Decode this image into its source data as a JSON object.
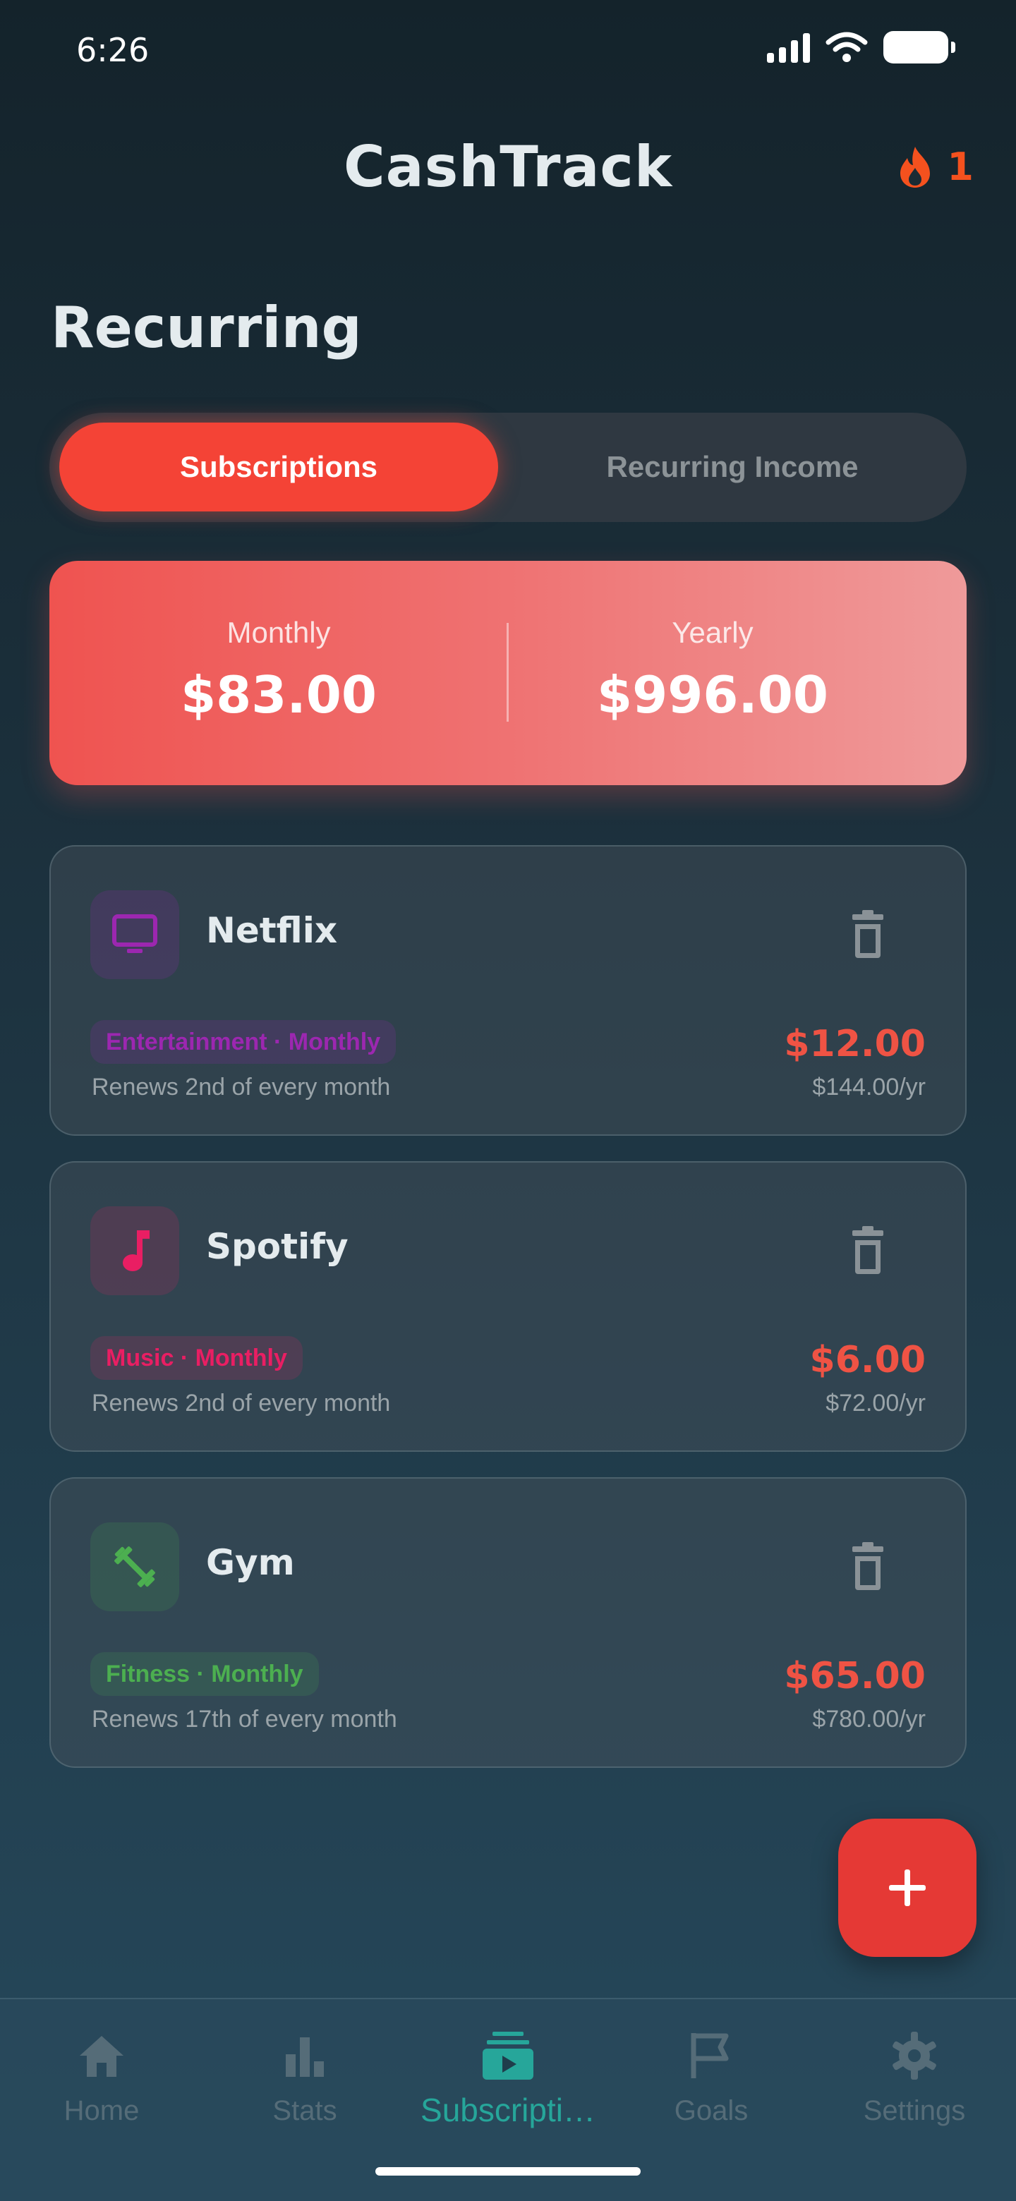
{
  "status_bar": {
    "time": "6:26"
  },
  "header": {
    "title": "CashTrack",
    "streak_count": "1"
  },
  "page": {
    "title": "Recurring"
  },
  "segmented": {
    "active": "Subscriptions",
    "inactive": "Recurring Income"
  },
  "summary": {
    "monthly_label": "Monthly",
    "monthly_value": "$83.00",
    "yearly_label": "Yearly",
    "yearly_value": "$996.00"
  },
  "subscriptions": [
    {
      "name": "Netflix",
      "icon": "tv-icon",
      "badge": "Entertainment · Monthly",
      "renews": "Renews 2nd of every month",
      "amount": "$12.00",
      "yearly": "$144.00/yr",
      "color": "#9c27b0"
    },
    {
      "name": "Spotify",
      "icon": "music-note-icon",
      "badge": "Music · Monthly",
      "renews": "Renews 2nd of every month",
      "amount": "$6.00",
      "yearly": "$72.00/yr",
      "color": "#e91e63"
    },
    {
      "name": "Gym",
      "icon": "dumbbell-icon",
      "badge": "Fitness · Monthly",
      "renews": "Renews 17th of every month",
      "amount": "$65.00",
      "yearly": "$780.00/yr",
      "color": "#4caf50"
    }
  ],
  "nav": [
    {
      "label": "Home",
      "icon": "home-icon"
    },
    {
      "label": "Stats",
      "icon": "bar-chart-icon"
    },
    {
      "label": "Subscripti…",
      "icon": "subscriptions-icon",
      "active": true
    },
    {
      "label": "Goals",
      "icon": "flag-icon"
    },
    {
      "label": "Settings",
      "icon": "gear-icon"
    }
  ],
  "colors": {
    "accent": "#f44336",
    "active_nav": "#26a69a",
    "amount": "#ef5344"
  }
}
